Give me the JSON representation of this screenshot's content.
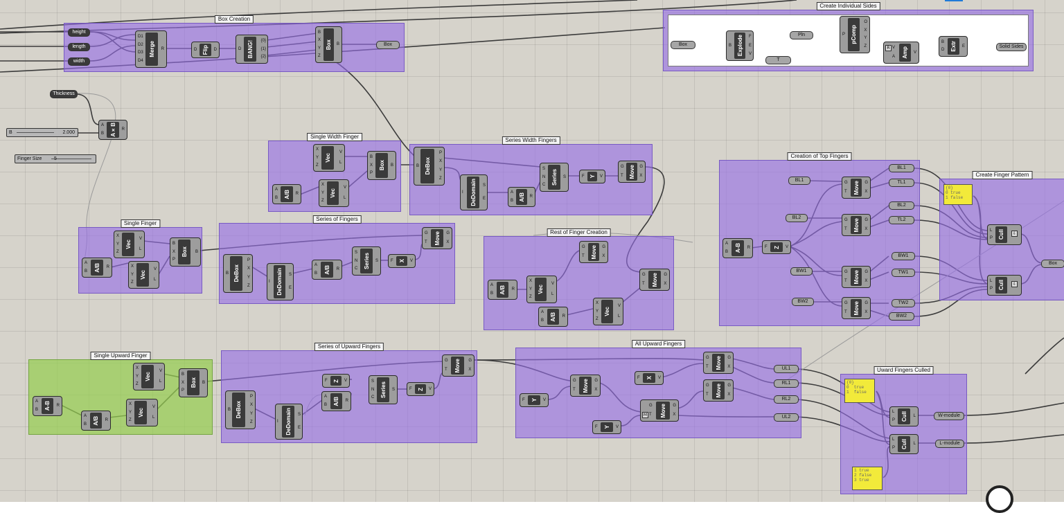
{
  "groups": {
    "box_creation": "Box Creation",
    "create_individual_sides": "Create Individual Sides",
    "single_width_finger": "Single Width Finger",
    "series_width_fingers": "Series Width Fingers",
    "creation_of_top_fingers": "Creation of Top Fingers",
    "create_finger_pattern": "Create Finger Pattern",
    "single_finger": "Single Finger",
    "series_of_fingers": "Series of Fingers",
    "rest_of_finger_creation": "Rest of Finger Creation",
    "single_upward_finger": "Single Upward Finger",
    "series_of_upward_fingers": "Series of Upward Fingers",
    "all_upward_fingers": "All Upward Fingers",
    "uward_fingers_culled": "Uward Fingers Culled"
  },
  "params": {
    "height": "height",
    "length": "length",
    "width": "width",
    "thickness": "Thickness",
    "box_out": "Box",
    "box_in": "Box",
    "pln": "Pln",
    "t": "T",
    "solid_sides": "Solid Sides",
    "bl1a": "BL1",
    "bl1b": "BL1",
    "tl1": "TL1",
    "bl2a": "BL2",
    "bl2b": "BL2",
    "tl2": "TL2",
    "bw1a": "BW1",
    "bw1b": "BW1",
    "tw1": "TW1",
    "bw2a": "BW2",
    "bw2b": "BW2",
    "tw2": "TW2",
    "box_right": "Box",
    "ul1": "UL1",
    "rl1": "RL1",
    "rl2": "RL2",
    "ul2": "UL2",
    "w_module": "W-module",
    "l_module": "L-module"
  },
  "sliders": {
    "b": {
      "label": "B",
      "value": "2.000"
    },
    "finger_size": {
      "label": "Finger Size",
      "value": "5"
    }
  },
  "components": {
    "merge": "Merge",
    "flip": "Flip",
    "bang": "BANG!",
    "box": "Box",
    "explode": "Explode",
    "pcomp": "pComp",
    "amp": "Amp",
    "extr": "Extr",
    "axb": "A×B",
    "vec": "Vec",
    "adivb": "A/B",
    "debox": "DeBox",
    "dedomain": "DeDomain",
    "series": "Series",
    "y": "Y",
    "x": "X",
    "z": "Z",
    "move": "Move",
    "amb": "A-B",
    "cull": "Cull"
  },
  "panels": {
    "pattern_top": [
      "{0}",
      "0 true",
      "1 false"
    ],
    "pattern_upward": [
      "{0}",
      "0  true",
      "1  false"
    ],
    "pattern_bottom": [
      "1 true",
      "2 false",
      "3 true"
    ]
  }
}
